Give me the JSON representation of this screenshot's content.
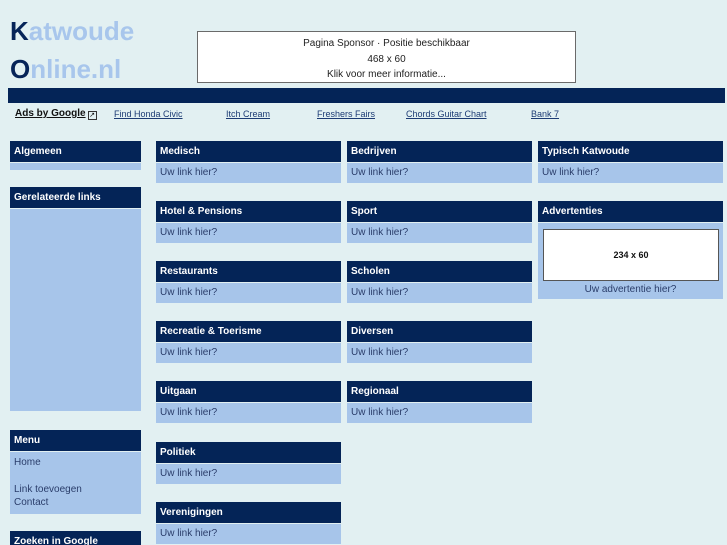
{
  "logo": {
    "line1_cap": "K",
    "line1_rest": "atwoude",
    "line2_cap": "O",
    "line2_rest": "nline.nl"
  },
  "sponsor": {
    "line1": "Pagina Sponsor · Positie beschikbaar",
    "line2": "468 x 60",
    "line3": "Klik voor meer informatie..."
  },
  "ads": {
    "label": "Ads by Google",
    "icon": "external-link-icon",
    "links": [
      "Find Honda Civic",
      "Itch Cream",
      "Freshers Fairs",
      "Chords Guitar Chart",
      "Bank 7"
    ]
  },
  "left": {
    "algemeen": {
      "title": "Algemeen"
    },
    "gerelateerd": {
      "title": "Gerelateerde links"
    },
    "menu": {
      "title": "Menu",
      "items": [
        "Home",
        "Link toevoegen",
        "Contact"
      ]
    },
    "zoeken": {
      "title": "Zoeken in Google"
    }
  },
  "categories": {
    "col1": [
      {
        "title": "Medisch",
        "link": "Uw link hier?"
      },
      {
        "title": "Hotel & Pensions",
        "link": "Uw link hier?"
      },
      {
        "title": "Restaurants",
        "link": "Uw link hier?"
      },
      {
        "title": "Recreatie & Toerisme",
        "link": "Uw link hier?"
      },
      {
        "title": "Uitgaan",
        "link": "Uw link hier?"
      },
      {
        "title": "Politiek",
        "link": "Uw link hier?"
      },
      {
        "title": "Verenigingen",
        "link": "Uw link hier?"
      }
    ],
    "col2": [
      {
        "title": "Bedrijven",
        "link": "Uw link hier?"
      },
      {
        "title": "Sport",
        "link": "Uw link hier?"
      },
      {
        "title": "Scholen",
        "link": "Uw link hier?"
      },
      {
        "title": "Diversen",
        "link": "Uw link hier?"
      },
      {
        "title": "Regionaal",
        "link": "Uw link hier?"
      }
    ]
  },
  "right": {
    "typisch": {
      "title": "Typisch Katwoude",
      "link": "Uw link hier?"
    },
    "advertenties": {
      "title": "Advertenties",
      "banner": "234 x 60",
      "link": "Uw advertentie hier?"
    }
  }
}
